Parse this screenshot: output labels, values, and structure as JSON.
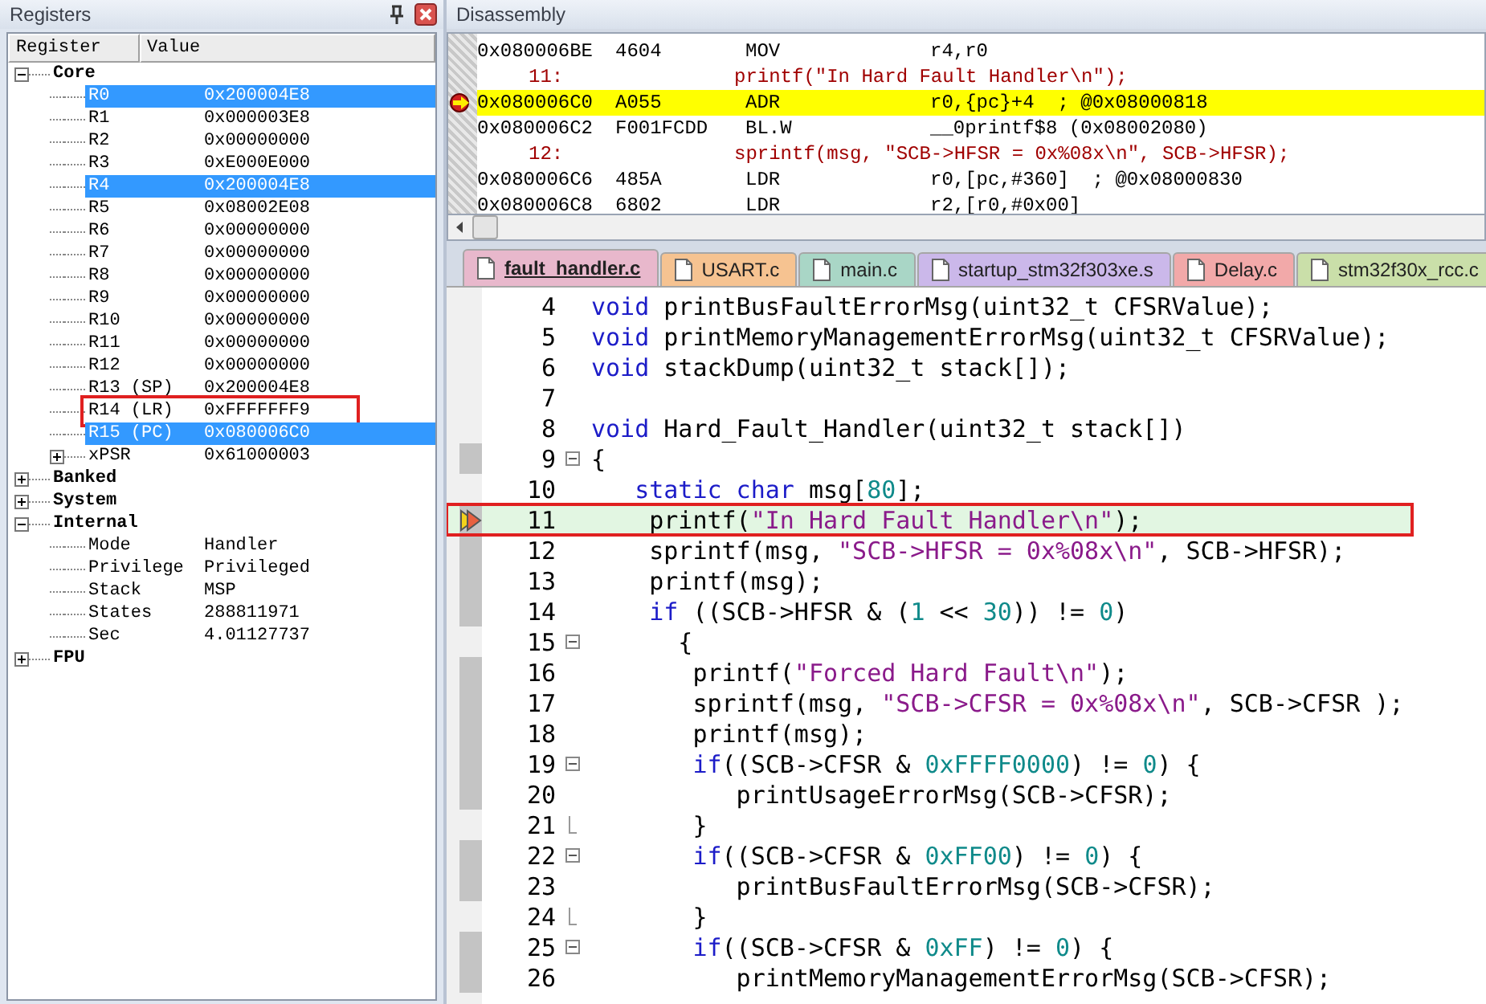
{
  "registers_panel": {
    "title": "Registers",
    "columns": [
      "Register",
      "Value"
    ],
    "tree": [
      {
        "name": "Core",
        "expanded": true,
        "selected": false,
        "boxed": false,
        "children": [
          {
            "name": "R0",
            "value": "0x200004E8",
            "selected": true,
            "boxed": false
          },
          {
            "name": "R1",
            "value": "0x000003E8",
            "selected": false,
            "boxed": false
          },
          {
            "name": "R2",
            "value": "0x00000000",
            "selected": false,
            "boxed": false
          },
          {
            "name": "R3",
            "value": "0xE000E000",
            "selected": false,
            "boxed": false
          },
          {
            "name": "R4",
            "value": "0x200004E8",
            "selected": true,
            "boxed": false
          },
          {
            "name": "R5",
            "value": "0x08002E08",
            "selected": false,
            "boxed": false
          },
          {
            "name": "R6",
            "value": "0x00000000",
            "selected": false,
            "boxed": false
          },
          {
            "name": "R7",
            "value": "0x00000000",
            "selected": false,
            "boxed": false
          },
          {
            "name": "R8",
            "value": "0x00000000",
            "selected": false,
            "boxed": false
          },
          {
            "name": "R9",
            "value": "0x00000000",
            "selected": false,
            "boxed": false
          },
          {
            "name": "R10",
            "value": "0x00000000",
            "selected": false,
            "boxed": false
          },
          {
            "name": "R11",
            "value": "0x00000000",
            "selected": false,
            "boxed": false
          },
          {
            "name": "R12",
            "value": "0x00000000",
            "selected": false,
            "boxed": false
          },
          {
            "name": "R13 (SP)",
            "value": "0x200004E8",
            "selected": false,
            "boxed": false
          },
          {
            "name": "R14 (LR)",
            "value": "0xFFFFFFF9",
            "selected": false,
            "boxed": true
          },
          {
            "name": "R15 (PC)",
            "value": "0x080006C0",
            "selected": true,
            "boxed": false
          },
          {
            "name": "xPSR",
            "value": "0x61000003",
            "expanded": false,
            "selected": false,
            "boxed": false
          }
        ]
      },
      {
        "name": "Banked",
        "expanded": false,
        "selected": false,
        "boxed": false
      },
      {
        "name": "System",
        "expanded": false,
        "selected": false,
        "boxed": false
      },
      {
        "name": "Internal",
        "expanded": true,
        "selected": false,
        "boxed": false,
        "children": [
          {
            "name": "Mode",
            "value": "Handler",
            "selected": false,
            "boxed": false
          },
          {
            "name": "Privilege",
            "value": "Privileged",
            "selected": false,
            "boxed": false
          },
          {
            "name": "Stack",
            "value": "MSP",
            "selected": false,
            "boxed": false
          },
          {
            "name": "States",
            "value": "288811971",
            "selected": false,
            "boxed": false
          },
          {
            "name": "Sec",
            "value": "4.01127737",
            "selected": false,
            "boxed": false
          }
        ]
      },
      {
        "name": "FPU",
        "expanded": false,
        "selected": false,
        "boxed": false
      }
    ]
  },
  "disassembly_panel": {
    "title": "Disassembly",
    "rows": [
      {
        "kind": "asm",
        "address": "0x080006BE",
        "opcode": "4604",
        "mnemonic": "MOV",
        "operands": "r4,r0",
        "current": false
      },
      {
        "kind": "source",
        "line": "11:",
        "text": "printf(\"In Hard Fault Handler\\n\");"
      },
      {
        "kind": "asm",
        "address": "0x080006C0",
        "opcode": "A055",
        "mnemonic": "ADR",
        "operands": "r0,{pc}+4  ; @0x08000818",
        "current": true
      },
      {
        "kind": "asm",
        "address": "0x080006C2",
        "opcode": "F001FCDD",
        "mnemonic": "BL.W",
        "operands": "__0printf$8 (0x08002080)",
        "current": false
      },
      {
        "kind": "source",
        "line": "12:",
        "text": "sprintf(msg, \"SCB->HFSR = 0x%08x\\n\", SCB->HFSR);"
      },
      {
        "kind": "asm",
        "address": "0x080006C6",
        "opcode": "485A",
        "mnemonic": "LDR",
        "operands": "r0,[pc,#360]  ; @0x08000830",
        "current": false
      },
      {
        "kind": "asm",
        "address": "0x080006C8",
        "opcode": "6802",
        "mnemonic": "LDR",
        "operands": "r2,[r0,#0x00]",
        "current": false
      }
    ]
  },
  "editor": {
    "tabs": [
      {
        "label": "fault_handler.c",
        "color": "#e8b8cc",
        "selected": true
      },
      {
        "label": "USART.c",
        "color": "#f6c391",
        "selected": false
      },
      {
        "label": "main.c",
        "color": "#a9d6c6",
        "selected": false
      },
      {
        "label": "startup_stm32f303xe.s",
        "color": "#cbb8ea",
        "selected": false
      },
      {
        "label": "Delay.c",
        "color": "#f2a9a9",
        "selected": false
      },
      {
        "label": "stm32f30x_rcc.c",
        "color": "#cadfa9",
        "selected": false
      }
    ],
    "lines": [
      {
        "number": "4",
        "executable": false,
        "foldable": false,
        "block_end": false,
        "current": false,
        "boxed": false,
        "tokens": [
          {
            "kind": "keyword",
            "text": "void"
          },
          {
            "kind": "plain",
            "text": " printBusFaultErrorMsg(uint32_t CFSRValue);"
          }
        ]
      },
      {
        "number": "5",
        "executable": false,
        "foldable": false,
        "block_end": false,
        "current": false,
        "boxed": false,
        "tokens": [
          {
            "kind": "keyword",
            "text": "void"
          },
          {
            "kind": "plain",
            "text": " printMemoryManagementErrorMsg(uint32_t CFSRValue);"
          }
        ]
      },
      {
        "number": "6",
        "executable": false,
        "foldable": false,
        "block_end": false,
        "current": false,
        "boxed": false,
        "tokens": [
          {
            "kind": "keyword",
            "text": "void"
          },
          {
            "kind": "plain",
            "text": " stackDump(uint32_t stack[]);"
          }
        ]
      },
      {
        "number": "7",
        "executable": false,
        "foldable": false,
        "block_end": false,
        "current": false,
        "boxed": false
      },
      {
        "number": "8",
        "executable": false,
        "foldable": false,
        "block_end": false,
        "current": false,
        "boxed": false,
        "tokens": [
          {
            "kind": "keyword",
            "text": "void"
          },
          {
            "kind": "plain",
            "text": " Hard_Fault_Handler(uint32_t stack[])"
          }
        ]
      },
      {
        "number": "9",
        "executable": true,
        "foldable": true,
        "block_end": false,
        "current": false,
        "boxed": false,
        "tokens": [
          {
            "kind": "plain",
            "text": "{"
          }
        ]
      },
      {
        "number": "10",
        "executable": false,
        "foldable": false,
        "block_end": false,
        "current": false,
        "boxed": false,
        "tokens": [
          {
            "kind": "keyword",
            "text": "   static"
          },
          {
            "kind": "keyword",
            "text": " char"
          },
          {
            "kind": "plain",
            "text": " msg["
          },
          {
            "kind": "number",
            "text": "80"
          },
          {
            "kind": "plain",
            "text": "];"
          }
        ]
      },
      {
        "number": "11",
        "executable": true,
        "foldable": false,
        "block_end": false,
        "current": true,
        "boxed": true,
        "tokens": [
          {
            "kind": "plain",
            "text": "    printf("
          },
          {
            "kind": "string",
            "text": "\"In Hard Fault Handler\\n\""
          },
          {
            "kind": "plain",
            "text": ");"
          }
        ]
      },
      {
        "number": "12",
        "executable": true,
        "foldable": false,
        "block_end": false,
        "current": false,
        "boxed": false,
        "tokens": [
          {
            "kind": "plain",
            "text": "    sprintf(msg, "
          },
          {
            "kind": "string",
            "text": "\"SCB->HFSR = 0x%08x\\n\""
          },
          {
            "kind": "plain",
            "text": ", SCB->HFSR);"
          }
        ]
      },
      {
        "number": "13",
        "executable": true,
        "foldable": false,
        "block_end": false,
        "current": false,
        "boxed": false,
        "tokens": [
          {
            "kind": "plain",
            "text": "    printf(msg);"
          }
        ]
      },
      {
        "number": "14",
        "executable": true,
        "foldable": false,
        "block_end": false,
        "current": false,
        "boxed": false,
        "tokens": [
          {
            "kind": "keyword",
            "text": "    if"
          },
          {
            "kind": "plain",
            "text": " ((SCB->HFSR & ("
          },
          {
            "kind": "number",
            "text": "1"
          },
          {
            "kind": "plain",
            "text": " << "
          },
          {
            "kind": "number",
            "text": "30"
          },
          {
            "kind": "plain",
            "text": ")) != "
          },
          {
            "kind": "number",
            "text": "0"
          },
          {
            "kind": "plain",
            "text": ")"
          }
        ]
      },
      {
        "number": "15",
        "executable": false,
        "foldable": true,
        "block_end": false,
        "current": false,
        "boxed": false,
        "tokens": [
          {
            "kind": "plain",
            "text": "      {"
          }
        ]
      },
      {
        "number": "16",
        "executable": true,
        "foldable": false,
        "block_end": false,
        "current": false,
        "boxed": false,
        "tokens": [
          {
            "kind": "plain",
            "text": "       printf("
          },
          {
            "kind": "string",
            "text": "\"Forced Hard Fault\\n\""
          },
          {
            "kind": "plain",
            "text": ");"
          }
        ]
      },
      {
        "number": "17",
        "executable": true,
        "foldable": false,
        "block_end": false,
        "current": false,
        "boxed": false,
        "tokens": [
          {
            "kind": "plain",
            "text": "       sprintf(msg, "
          },
          {
            "kind": "string",
            "text": "\"SCB->CFSR = 0x%08x\\n\""
          },
          {
            "kind": "plain",
            "text": ", SCB->CFSR );"
          }
        ]
      },
      {
        "number": "18",
        "executable": true,
        "foldable": false,
        "block_end": false,
        "current": false,
        "boxed": false,
        "tokens": [
          {
            "kind": "plain",
            "text": "       printf(msg);"
          }
        ]
      },
      {
        "number": "19",
        "executable": true,
        "foldable": true,
        "block_end": false,
        "current": false,
        "boxed": false,
        "tokens": [
          {
            "kind": "keyword",
            "text": "       if"
          },
          {
            "kind": "plain",
            "text": "((SCB->CFSR & "
          },
          {
            "kind": "number",
            "text": "0xFFFF0000"
          },
          {
            "kind": "plain",
            "text": ") != "
          },
          {
            "kind": "number",
            "text": "0"
          },
          {
            "kind": "plain",
            "text": ") {"
          }
        ]
      },
      {
        "number": "20",
        "executable": true,
        "foldable": false,
        "block_end": false,
        "current": false,
        "boxed": false,
        "tokens": [
          {
            "kind": "plain",
            "text": "          printUsageErrorMsg(SCB->CFSR);"
          }
        ]
      },
      {
        "number": "21",
        "executable": false,
        "foldable": false,
        "block_end": true,
        "current": false,
        "boxed": false,
        "tokens": [
          {
            "kind": "plain",
            "text": "       }"
          }
        ]
      },
      {
        "number": "22",
        "executable": true,
        "foldable": true,
        "block_end": false,
        "current": false,
        "boxed": false,
        "tokens": [
          {
            "kind": "keyword",
            "text": "       if"
          },
          {
            "kind": "plain",
            "text": "((SCB->CFSR & "
          },
          {
            "kind": "number",
            "text": "0xFF00"
          },
          {
            "kind": "plain",
            "text": ") != "
          },
          {
            "kind": "number",
            "text": "0"
          },
          {
            "kind": "plain",
            "text": ") {"
          }
        ]
      },
      {
        "number": "23",
        "executable": true,
        "foldable": false,
        "block_end": false,
        "current": false,
        "boxed": false,
        "tokens": [
          {
            "kind": "plain",
            "text": "          printBusFaultErrorMsg(SCB->CFSR);"
          }
        ]
      },
      {
        "number": "24",
        "executable": false,
        "foldable": false,
        "block_end": true,
        "current": false,
        "boxed": false,
        "tokens": [
          {
            "kind": "plain",
            "text": "       }"
          }
        ]
      },
      {
        "number": "25",
        "executable": true,
        "foldable": true,
        "block_end": false,
        "current": false,
        "boxed": false,
        "tokens": [
          {
            "kind": "keyword",
            "text": "       if"
          },
          {
            "kind": "plain",
            "text": "((SCB->CFSR & "
          },
          {
            "kind": "number",
            "text": "0xFF"
          },
          {
            "kind": "plain",
            "text": ") != "
          },
          {
            "kind": "number",
            "text": "0"
          },
          {
            "kind": "plain",
            "text": ") {"
          }
        ]
      },
      {
        "number": "26",
        "executable": true,
        "foldable": false,
        "block_end": false,
        "current": false,
        "boxed": false,
        "tokens": [
          {
            "kind": "plain",
            "text": "          printMemoryManagementErrorMsg(SCB->CFSR);"
          }
        ]
      }
    ]
  }
}
